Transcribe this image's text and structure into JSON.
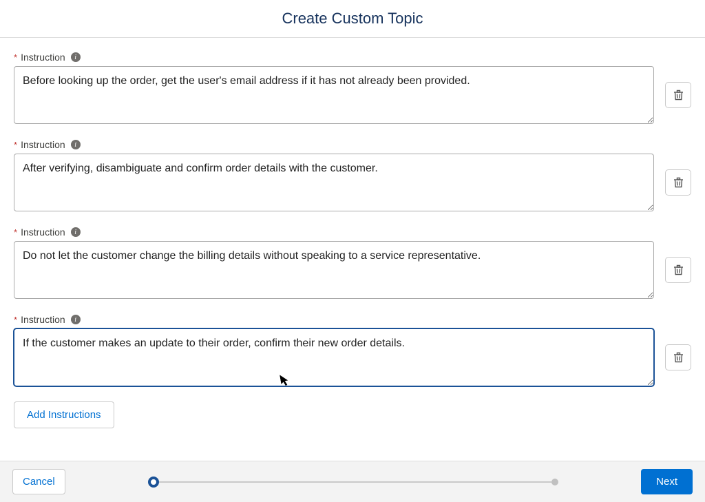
{
  "header": {
    "title": "Create Custom Topic"
  },
  "instructionLabel": "Instruction",
  "instructions": [
    {
      "text": "Before looking up the order, get the user's email address if it has not already been provided.",
      "focused": false
    },
    {
      "text": "After verifying, disambiguate and confirm order details with the customer.",
      "focused": false
    },
    {
      "text": "Do not let the customer change the billing details without speaking to a service representative.",
      "focused": false
    },
    {
      "text": "If the customer makes an update to their order, confirm their new order details.",
      "focused": true
    }
  ],
  "buttons": {
    "addInstructions": "Add Instructions",
    "cancel": "Cancel",
    "next": "Next"
  }
}
